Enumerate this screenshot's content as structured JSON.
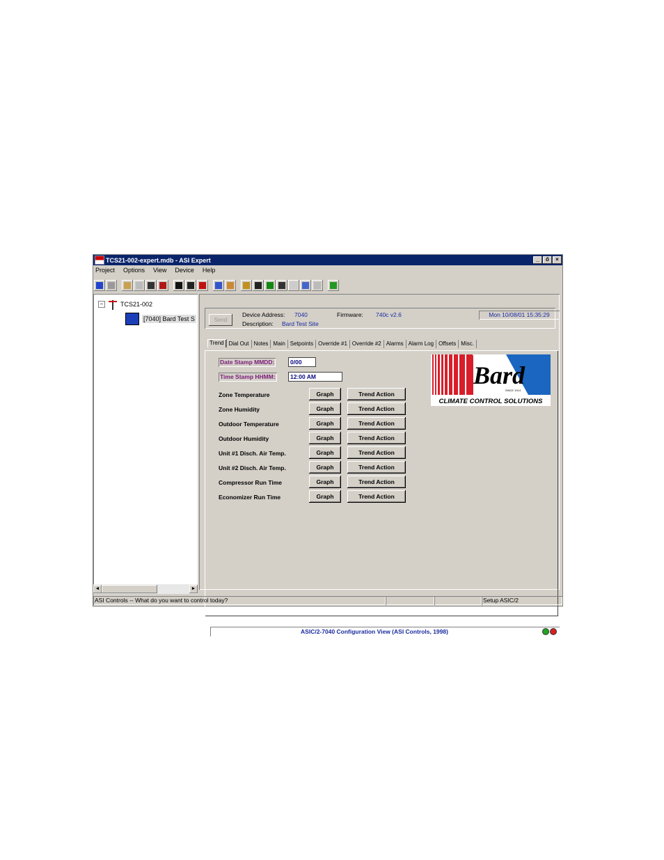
{
  "window": {
    "title": "TCS21-002-expert.mdb - ASI Expert",
    "controls": {
      "minimize": "_",
      "restore": "ő",
      "close": "×"
    }
  },
  "menu": [
    "Project",
    "Options",
    "View",
    "Device",
    "Help"
  ],
  "tree": {
    "root": "TCS21-002",
    "root_expander": "−",
    "child": "[7040] Bard Test S"
  },
  "scroll": {
    "left": "◄",
    "right": "►"
  },
  "device": {
    "send_label": "Send",
    "address_label": "Device Address:",
    "address_value": "7040",
    "firmware_label": "Firmware:",
    "firmware_value": "740c v2.6",
    "description_label": "Description:",
    "description_value": "Bard Test Site",
    "datetime": "Mon  10/08/01  15:35:29"
  },
  "tabs": [
    "Trend",
    "Dial Out",
    "Notes",
    "Main",
    "Setpoints",
    "Override #1",
    "Override #2",
    "Alarms",
    "Alarm Log",
    "Offsets",
    "Misc."
  ],
  "trend": {
    "date_stamp_label": "Date Stamp MMDD:",
    "date_stamp_value": "0/00",
    "time_stamp_label": "Time Stamp HHMM:",
    "time_stamp_value": "12:00 AM",
    "graph_label": "Graph",
    "action_label": "Trend Action",
    "rows": [
      "Zone Temperature",
      "Zone Humidity",
      "Outdoor Temperature",
      "Outdoor Humidity",
      "Unit #1 Disch. Air Temp.",
      "Unit #2 Disch. Air Temp.",
      "Compressor Run Time",
      "Economizer Run Time"
    ]
  },
  "logo": {
    "brand": "Bard",
    "since": "SINCE 1914",
    "tagline": "CLIMATE CONTROL SOLUTIONS"
  },
  "view_status": "ASIC/2-7040 Configuration View (ASI Controls, 1998)",
  "statusbar": {
    "message": "ASI Controls -- What do you want to control today?",
    "mode": "Setup ASIC/2"
  }
}
